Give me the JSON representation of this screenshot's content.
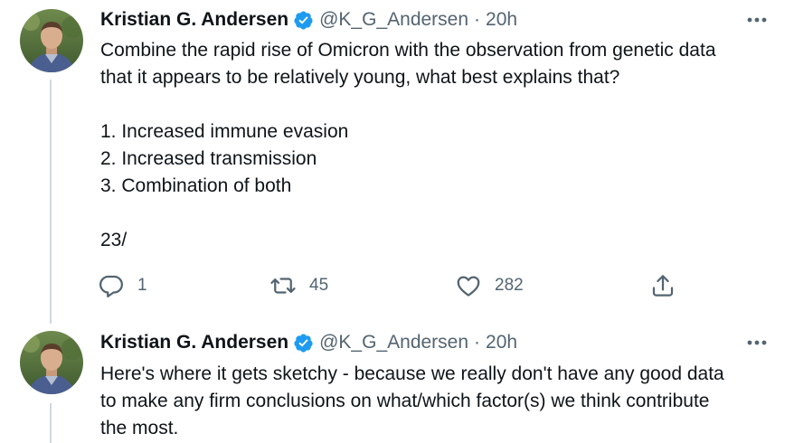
{
  "tweets": [
    {
      "author": {
        "name": "Kristian G. Andersen",
        "handle": "@K_G_Andersen",
        "separator": "·",
        "time": "20h"
      },
      "text_lines": [
        "Combine the rapid rise of Omicron with the observation from genetic data",
        "that it appears to be relatively young, what best explains that?",
        "",
        "1. Increased immune evasion",
        "2. Increased transmission",
        "3. Combination of both",
        "",
        "23/"
      ],
      "actions": {
        "replies": "1",
        "retweets": "45",
        "likes": "282"
      }
    },
    {
      "author": {
        "name": "Kristian G. Andersen",
        "handle": "@K_G_Andersen",
        "separator": "·",
        "time": "20h"
      },
      "text_lines": [
        "Here's where it gets sketchy - because we really don't have any good data",
        "to make any firm conclusions on what/which factor(s) we think contribute",
        "the most."
      ]
    }
  ],
  "icons": {
    "verified": "verified-badge-icon",
    "more": "more-options-icon",
    "reply": "reply-icon",
    "retweet": "retweet-icon",
    "like": "heart-icon",
    "share": "share-icon"
  },
  "colors": {
    "verified": "#1d9bf0",
    "secondary_text": "#536471",
    "primary_text": "#0f1419",
    "thread_line": "#cfd9de"
  }
}
